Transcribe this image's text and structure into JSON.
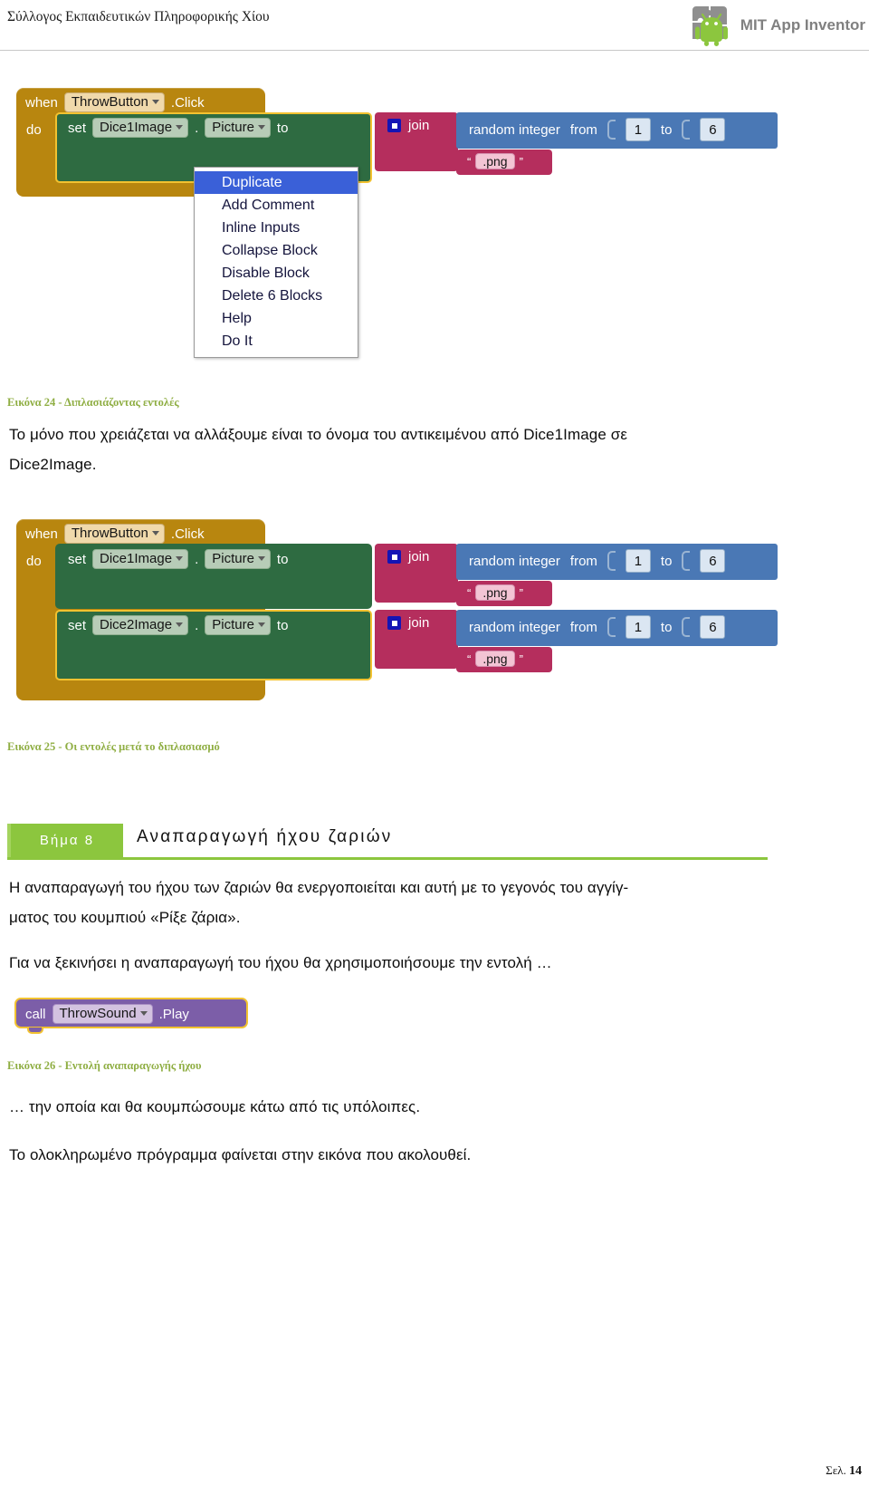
{
  "header": {
    "title": "Σύλλογος Εκπαιδευτικών Πληροφορικής Χίου",
    "logo_text": "MIT App Inventor",
    "logo_icon": "android-puzzle-logo"
  },
  "figure24": {
    "caption": "Εικόνα 24 - Διπλασιάζοντας εντολές",
    "blocks": {
      "when_label": "when",
      "when_component": "ThrowButton",
      "when_event": ".Click",
      "do_label": "do",
      "set_label": "set",
      "set_component": "Dice1Image",
      "dot": ".",
      "set_property": "Picture",
      "to_label": "to",
      "join_label": "join",
      "random_label": "random integer",
      "from_label": "from",
      "range_from": "1",
      "range_to_label": "to",
      "range_to": "6",
      "quote_open": "“",
      "string_value": ".png",
      "quote_close": "”"
    },
    "context_menu": {
      "items": [
        "Duplicate",
        "Add Comment",
        "Inline Inputs",
        "Collapse Block",
        "Disable Block",
        "Delete 6 Blocks",
        "Help",
        "Do It"
      ],
      "selected_index": 0,
      "highlight_color": "#3a60d8"
    }
  },
  "paragraph1": {
    "line1": "Το μόνο που χρειάζεται να αλλάξουμε είναι το όνομα του αντικειμένου από Dice1Image σε",
    "line2": "Dice2Image."
  },
  "figure25": {
    "caption": "Εικόνα 25 - Οι εντολές μετά το διπλασιασμό",
    "blocks": {
      "when_label": "when",
      "when_component": "ThrowButton",
      "when_event": ".Click",
      "do_label": "do",
      "set_label": "set",
      "row1_component": "Dice1Image",
      "row2_component": "Dice2Image",
      "dot": ".",
      "set_property": "Picture",
      "to_label": "to",
      "join_label": "join",
      "random_label": "random integer",
      "from_label": "from",
      "range_from": "1",
      "range_to_label": "to",
      "range_to": "6",
      "quote_open": "“",
      "string_value": ".png",
      "quote_close": "”"
    }
  },
  "step8": {
    "badge": "Βήμα 8",
    "title": "Αναπαραγωγή ήχου ζαριών",
    "accent_color": "#8cc63e"
  },
  "paragraph2": {
    "line1": "Η αναπαραγωγή του ήχου των ζαριών θα ενεργοποιείται και αυτή με το γεγονός του αγγίγ-",
    "line2": "ματος του κουμπιού «Ρίξε ζάρια»."
  },
  "paragraph3": {
    "line1": "Για να ξεκινήσει η αναπαραγωγή του ήχου θα χρησιμοποιήσουμε την εντολή …"
  },
  "figure26": {
    "caption": "Εικόνα 26 - Εντολή αναπαραγωγής ήχου",
    "blocks": {
      "call_label": "call",
      "component": "ThrowSound",
      "method": ".Play"
    }
  },
  "paragraph4": {
    "line1": "… την οποία και θα κουμπώσουμε κάτω από τις υπόλοιπες."
  },
  "paragraph5": {
    "line1": "Το ολοκληρωμένο πρόγραμμα φαίνεται στην εικόνα που ακολουθεί."
  },
  "footer": {
    "prefix": "Σελ. ",
    "page_number": "14"
  }
}
